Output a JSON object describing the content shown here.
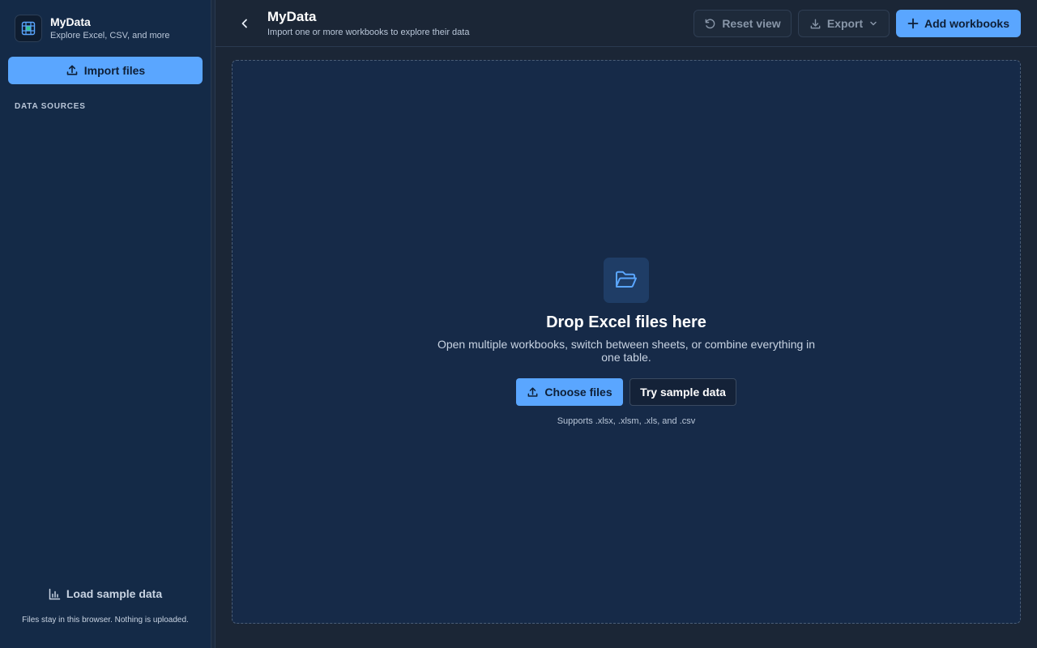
{
  "sidebar": {
    "brand_title": "MyData",
    "brand_subtitle": "Explore Excel, CSV, and more",
    "import_label": "Import files",
    "section_label": "DATA SOURCES",
    "load_sample_label": "Load sample data",
    "footer_note": "Files stay in this browser. Nothing is uploaded."
  },
  "header": {
    "title": "MyData",
    "subtitle": "Import one or more workbooks to explore their data",
    "reset_label": "Reset view",
    "export_label": "Export",
    "add_label": "Add workbooks"
  },
  "dropzone": {
    "title": "Drop Excel files here",
    "description": "Open multiple workbooks, switch between sheets, or combine everything in one table.",
    "choose_label": "Choose files",
    "sample_label": "Try sample data",
    "supports": "Supports .xlsx, .xlsm, .xls, and .csv"
  },
  "icons": {
    "brand": "spreadsheet-grid-icon",
    "import": "upload-icon",
    "load_sample": "bar-chart-icon",
    "back": "chevron-left-icon",
    "reset": "rotate-ccw-icon",
    "export": "download-icon",
    "export_menu": "chevron-down-icon",
    "add": "plus-icon",
    "folder": "folder-open-icon",
    "choose": "upload-icon"
  },
  "colors": {
    "accent": "#5aa6ff",
    "sidebar_bg": "#142a47",
    "page_bg": "#1b2636",
    "dropzone_bg": "#162a48"
  }
}
